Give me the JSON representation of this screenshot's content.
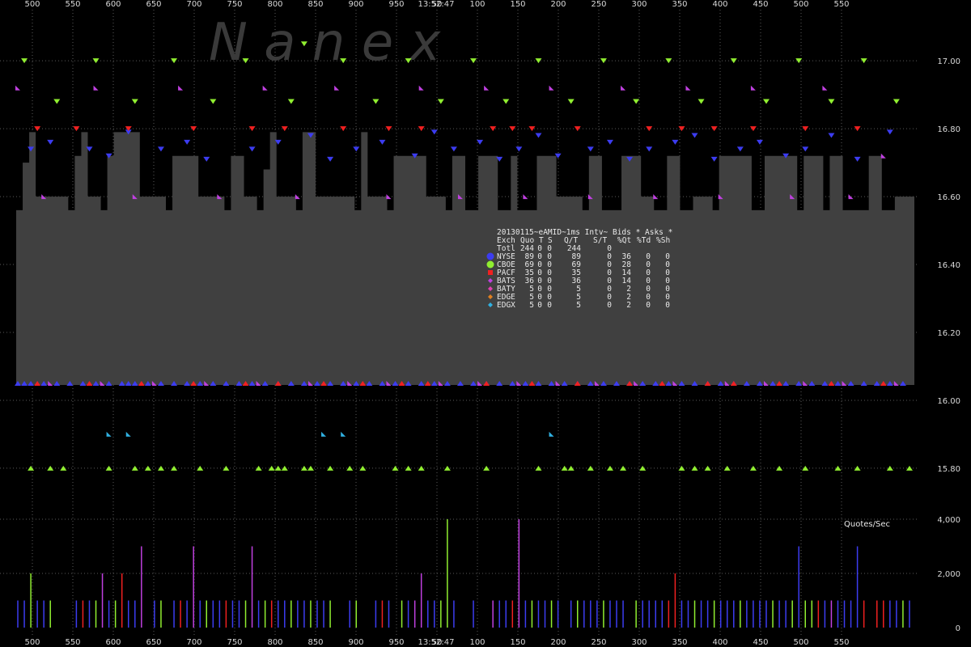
{
  "chart_data": {
    "type": "step-area",
    "watermark": "N a n e x",
    "top_time_label": "13:52:47",
    "bottom_time_label": "13:52:47",
    "x_ticks": [
      "500",
      "550",
      "600",
      "650",
      "700",
      "750",
      "800",
      "850",
      "900",
      "950",
      "50",
      "100",
      "150",
      "200",
      "250",
      "300",
      "350",
      "400",
      "450",
      "500",
      "550"
    ],
    "price_axis": {
      "ylim": [
        15.745,
        17.06
      ],
      "ticks": [
        "17.00",
        "16.80",
        "16.60",
        "16.40",
        "16.20",
        "16.00",
        "15.80"
      ]
    },
    "rate_axis": {
      "title": "Quotes/Sec",
      "ylim": [
        0,
        4100
      ],
      "ticks": [
        "4,000",
        "2,000",
        "0"
      ]
    },
    "colors": {
      "background": "#000000",
      "grid": "#5a5a5a",
      "area": "#404040",
      "NYSE": "#3c3cf0",
      "CBOE": "#90ee30",
      "PACF": "#f02020",
      "BATS": "#c040e0",
      "BATY": "#e040b0",
      "EDGE": "#e08020",
      "EDGX": "#30b0e0"
    },
    "legend": {
      "title": "20130115~eAMID~1ms Intv~ Bids * Asks *",
      "header": [
        "Exch",
        "Quo",
        "T",
        "S",
        "Q/T",
        "S/T",
        "%Qt",
        "%Td",
        "%Sh"
      ],
      "total": {
        "label": "Totl",
        "quo": "244",
        "t": "0",
        "s": "0",
        "qt": "244",
        "st": "0",
        "pqt": "",
        "ptd": "",
        "psh": ""
      },
      "rows": [
        {
          "exch": "NYSE",
          "quo": "89",
          "t": "0",
          "s": "0",
          "qt": "89",
          "st": "0",
          "pqt": "36",
          "ptd": "0",
          "psh": "0",
          "color": "#3c3cf0",
          "marker": "circle"
        },
        {
          "exch": "CBOE",
          "quo": "69",
          "t": "0",
          "s": "0",
          "qt": "69",
          "st": "0",
          "pqt": "28",
          "ptd": "0",
          "psh": "0",
          "color": "#90ee30",
          "marker": "circle"
        },
        {
          "exch": "PACF",
          "quo": "35",
          "t": "0",
          "s": "0",
          "qt": "35",
          "st": "0",
          "pqt": "14",
          "ptd": "0",
          "psh": "0",
          "color": "#f02020",
          "marker": "square"
        },
        {
          "exch": "BATS",
          "quo": "36",
          "t": "0",
          "s": "0",
          "qt": "36",
          "st": "0",
          "pqt": "14",
          "ptd": "0",
          "psh": "0",
          "color": "#c040e0",
          "marker": "diamond"
        },
        {
          "exch": "BATY",
          "quo": "5",
          "t": "0",
          "s": "0",
          "qt": "5",
          "st": "0",
          "pqt": "2",
          "ptd": "0",
          "psh": "0",
          "color": "#e040b0",
          "marker": "diamond"
        },
        {
          "exch": "EDGE",
          "quo": "5",
          "t": "0",
          "s": "0",
          "qt": "5",
          "st": "0",
          "pqt": "2",
          "ptd": "0",
          "psh": "0",
          "color": "#e08020",
          "marker": "diamond"
        },
        {
          "exch": "EDGX",
          "quo": "5",
          "t": "0",
          "s": "0",
          "qt": "5",
          "st": "0",
          "pqt": "2",
          "ptd": "0",
          "psh": "0",
          "color": "#30b0e0",
          "marker": "diamond"
        }
      ]
    },
    "best_bid": 16.05,
    "best_ask": [
      [
        0,
        16.56
      ],
      [
        1,
        16.7
      ],
      [
        2,
        16.79
      ],
      [
        3,
        16.6
      ],
      [
        8,
        16.56
      ],
      [
        9,
        16.72
      ],
      [
        10,
        16.79
      ],
      [
        11,
        16.6
      ],
      [
        13,
        16.56
      ],
      [
        14,
        16.72
      ],
      [
        15,
        16.79
      ],
      [
        19,
        16.6
      ],
      [
        23,
        16.56
      ],
      [
        24,
        16.72
      ],
      [
        28,
        16.6
      ],
      [
        32,
        16.56
      ],
      [
        33,
        16.72
      ],
      [
        35,
        16.6
      ],
      [
        37,
        16.56
      ],
      [
        38,
        16.68
      ],
      [
        39,
        16.79
      ],
      [
        40,
        16.6
      ],
      [
        43,
        16.56
      ],
      [
        44,
        16.79
      ],
      [
        46,
        16.6
      ],
      [
        52,
        16.56
      ],
      [
        53,
        16.79
      ],
      [
        54,
        16.6
      ],
      [
        57,
        16.56
      ],
      [
        58,
        16.72
      ],
      [
        63,
        16.6
      ],
      [
        66,
        16.56
      ],
      [
        67,
        16.72
      ],
      [
        69,
        16.56
      ],
      [
        71,
        16.72
      ],
      [
        74,
        16.56
      ],
      [
        76,
        16.72
      ],
      [
        77,
        16.56
      ],
      [
        80,
        16.72
      ],
      [
        83,
        16.6
      ],
      [
        87,
        16.56
      ],
      [
        88,
        16.72
      ],
      [
        90,
        16.56
      ],
      [
        93,
        16.72
      ],
      [
        96,
        16.6
      ],
      [
        98,
        16.56
      ],
      [
        100,
        16.72
      ],
      [
        102,
        16.56
      ],
      [
        104,
        16.6
      ],
      [
        107,
        16.56
      ],
      [
        108,
        16.72
      ],
      [
        113,
        16.56
      ],
      [
        115,
        16.72
      ],
      [
        120,
        16.56
      ],
      [
        121,
        16.72
      ],
      [
        124,
        16.56
      ],
      [
        125,
        16.72
      ],
      [
        127,
        16.56
      ],
      [
        131,
        16.72
      ],
      [
        133,
        16.56
      ],
      [
        135,
        16.6
      ],
      [
        138,
        16.56
      ]
    ],
    "ask_markers": [
      {
        "e": "CBOE",
        "t": [
          1,
          6,
          12,
          18,
          24,
          30,
          35,
          42,
          50,
          55,
          60,
          65,
          70,
          75,
          80,
          85,
          90,
          95,
          100,
          105,
          110,
          115,
          120,
          125,
          130,
          135
        ],
        "p": [
          17.0,
          16.88,
          17.0,
          16.88,
          17.0,
          16.88,
          17.0,
          16.88,
          17.0,
          16.88,
          17.0,
          16.88,
          17.0,
          16.88,
          17.0,
          16.88,
          17.0,
          16.88,
          17.0,
          16.88,
          17.0,
          16.88,
          17.0,
          16.88,
          17.0,
          16.88
        ]
      },
      {
        "e": "NYSE",
        "t": [
          2,
          5,
          11,
          14,
          17,
          22,
          26,
          29,
          36,
          40,
          45,
          48,
          52,
          56,
          61,
          64,
          67,
          71,
          74,
          77,
          80,
          83,
          88,
          91,
          94,
          97,
          101,
          104,
          107,
          111,
          114,
          118,
          121,
          125,
          129,
          134
        ],
        "p": [
          16.74,
          16.76,
          16.74,
          16.72,
          16.79,
          16.74,
          16.76,
          16.71,
          16.74,
          16.76,
          16.78,
          16.71,
          16.74,
          16.76,
          16.72,
          16.79,
          16.74,
          16.76,
          16.71,
          16.74,
          16.78,
          16.72,
          16.74,
          16.76,
          16.71,
          16.74,
          16.76,
          16.78,
          16.71,
          16.74,
          16.76,
          16.72,
          16.74,
          16.78,
          16.71,
          16.79
        ]
      },
      {
        "e": "PACF",
        "t": [
          3,
          9,
          17,
          27,
          36,
          41,
          50,
          57,
          62,
          73,
          76,
          79,
          86,
          97,
          102,
          107,
          113,
          121,
          129
        ],
        "p": [
          16.8,
          16.8,
          16.8,
          16.8,
          16.8,
          16.8,
          16.8,
          16.8,
          16.8,
          16.8,
          16.8,
          16.8,
          16.8,
          16.8,
          16.8,
          16.8,
          16.8,
          16.8,
          16.8
        ]
      },
      {
        "e": "BATS",
        "t": [
          0,
          4,
          12,
          18,
          25,
          31,
          38,
          43,
          49,
          57,
          62,
          68,
          72,
          78,
          82,
          88,
          93,
          98,
          103,
          108,
          113,
          119,
          124,
          128,
          133
        ],
        "p": [
          16.92,
          16.6,
          16.92,
          16.6,
          16.92,
          16.6,
          16.92,
          16.6,
          16.92,
          16.6,
          16.92,
          16.6,
          16.92,
          16.6,
          16.92,
          16.6,
          16.92,
          16.6,
          16.92,
          16.6,
          16.92,
          16.6,
          16.92,
          16.6,
          16.72
        ]
      },
      {
        "e": "CBOE",
        "t": [
          44
        ],
        "p": [
          17.05
        ]
      }
    ],
    "bid_markers": [
      {
        "e": "NYSE",
        "t": [
          0,
          1,
          2,
          4,
          6,
          8,
          10,
          12,
          14,
          16,
          17,
          18,
          20,
          22,
          24,
          26,
          28,
          30,
          32,
          34,
          36,
          38,
          40,
          42,
          44,
          46,
          48,
          50,
          52,
          54,
          56,
          58,
          60,
          62,
          64,
          66,
          68,
          70,
          72,
          74,
          76,
          78,
          80,
          82,
          84,
          86,
          88,
          90,
          92,
          94,
          96,
          98,
          100,
          102,
          104,
          106,
          108,
          110,
          112,
          114,
          116,
          118,
          120,
          122,
          124,
          126,
          128,
          130,
          132,
          134,
          136
        ],
        "p": 16.05
      },
      {
        "e": "PACF",
        "t": [
          3,
          11,
          19,
          27,
          35,
          40,
          47,
          53,
          59,
          63,
          72,
          79,
          86,
          94,
          99,
          106,
          110,
          117,
          125,
          133
        ],
        "p": 16.05
      },
      {
        "e": "BATS",
        "t": [
          5,
          13,
          21,
          29,
          37,
          45,
          51,
          57,
          65,
          71,
          77,
          83,
          89,
          95,
          101,
          109,
          115,
          121,
          127,
          135
        ],
        "p": 16.05
      },
      {
        "e": "EDGX",
        "t": [
          14,
          17,
          47,
          50,
          82
        ],
        "p": 15.9
      },
      {
        "e": "CBOE",
        "t": [
          2,
          5,
          7,
          14,
          18,
          20,
          22,
          24,
          28,
          32,
          37,
          39,
          40,
          41,
          44,
          45,
          48,
          51,
          53,
          58,
          60,
          62,
          66,
          72,
          80,
          84,
          85,
          88,
          91,
          93,
          96,
          102,
          104,
          106,
          109,
          113,
          117,
          121,
          126,
          129,
          134,
          137
        ],
        "p": 15.8
      }
    ],
    "rate_series": {
      "t": [
        0,
        1,
        2,
        3,
        4,
        5,
        6,
        7,
        8,
        9,
        10,
        11,
        12,
        13,
        14,
        15,
        16,
        17,
        18,
        19,
        20,
        21,
        22,
        23,
        24,
        25,
        26,
        27,
        28,
        29,
        30,
        31,
        32,
        33,
        34,
        35,
        36,
        37,
        38,
        39,
        40,
        41,
        42,
        43,
        44,
        45,
        46,
        47,
        48,
        49,
        50,
        51,
        52,
        53,
        54,
        55,
        56,
        57,
        58,
        59,
        60,
        61,
        62,
        63,
        64,
        65,
        66,
        67,
        68,
        69,
        70,
        71,
        72,
        73,
        74,
        75,
        76,
        77,
        78,
        79,
        80,
        81,
        82,
        83,
        84,
        85,
        86,
        87,
        88,
        89,
        90,
        91,
        92,
        93,
        94,
        95,
        96,
        97,
        98,
        99,
        100,
        101,
        102,
        103,
        104,
        105,
        106,
        107,
        108,
        109,
        110,
        111,
        112,
        113,
        114,
        115,
        116,
        117,
        118,
        119,
        120,
        121,
        122,
        123,
        124,
        125,
        126,
        127,
        128,
        129,
        130,
        131,
        132,
        133,
        134,
        135,
        136,
        137
      ],
      "v": [
        1000,
        1000,
        2000,
        1000,
        1000,
        1000,
        0,
        0,
        0,
        1000,
        1000,
        1000,
        1000,
        2000,
        1000,
        1000,
        2000,
        1000,
        1000,
        3000,
        0,
        1000,
        1000,
        0,
        1000,
        1000,
        1000,
        3000,
        1000,
        1000,
        1000,
        1000,
        1000,
        1000,
        1000,
        1000,
        3000,
        1000,
        1000,
        1000,
        1000,
        1000,
        1000,
        1000,
        1000,
        1000,
        1000,
        1000,
        1000,
        0,
        0,
        1000,
        1000,
        0,
        0,
        1000,
        1000,
        1000,
        0,
        1000,
        1000,
        1000,
        2000,
        1000,
        1000,
        1000,
        4000,
        1000,
        0,
        0,
        1000,
        0,
        0,
        1000,
        1000,
        1000,
        1000,
        4000,
        1000,
        1000,
        1000,
        1000,
        1000,
        1000,
        0,
        1000,
        1000,
        1000,
        1000,
        1000,
        1000,
        1000,
        1000,
        1000,
        0,
        1000,
        1000,
        1000,
        1000,
        1000,
        1000,
        2000,
        1000,
        1000,
        1000,
        1000,
        1000,
        1000,
        1000,
        1000,
        1000,
        1000,
        1000,
        1000,
        1000,
        1000,
        1000,
        1000,
        1000,
        1000,
        3000,
        1000,
        1000,
        1000,
        1000,
        1000,
        1000,
        1000,
        1000,
        3000,
        1000,
        0,
        1000,
        1000,
        1000,
        1000,
        1000,
        1000,
        2000,
        1000,
        1000,
        1000
      ],
      "e": [
        "NYSE",
        "NYSE",
        "CBOE",
        "NYSE",
        "NYSE",
        "CBOE",
        "NYSE",
        "NYSE",
        "NYSE",
        "NYSE",
        "PACF",
        "NYSE",
        "CBOE",
        "BATS",
        "NYSE",
        "CBOE",
        "PACF",
        "NYSE",
        "NYSE",
        "BATS",
        "NYSE",
        "NYSE",
        "CBOE",
        "NYSE",
        "NYSE",
        "PACF",
        "NYSE",
        "BATS",
        "NYSE",
        "CBOE",
        "NYSE",
        "NYSE",
        "PACF",
        "NYSE",
        "NYSE",
        "CBOE",
        "BATS",
        "NYSE",
        "CBOE",
        "PACF",
        "NYSE",
        "NYSE",
        "CBOE",
        "NYSE",
        "NYSE",
        "CBOE",
        "NYSE",
        "NYSE",
        "CBOE",
        "NYSE",
        "NYSE",
        "NYSE",
        "CBOE",
        "NYSE",
        "NYSE",
        "NYSE",
        "PACF",
        "NYSE",
        "NYSE",
        "CBOE",
        "NYSE",
        "BATS",
        "BATS",
        "NYSE",
        "NYSE",
        "CBOE",
        "CBOE",
        "NYSE",
        "NYSE",
        "NYSE",
        "NYSE",
        "NYSE",
        "NYSE",
        "BATS",
        "NYSE",
        "NYSE",
        "PACF",
        "BATS",
        "NYSE",
        "CBOE",
        "NYSE",
        "NYSE",
        "CBOE",
        "NYSE",
        "NYSE",
        "NYSE",
        "CBOE",
        "NYSE",
        "NYSE",
        "NYSE",
        "CBOE",
        "NYSE",
        "NYSE",
        "NYSE",
        "NYSE",
        "CBOE",
        "NYSE",
        "NYSE",
        "NYSE",
        "NYSE",
        "PACF",
        "PACF",
        "NYSE",
        "NYSE",
        "CBOE",
        "NYSE",
        "NYSE",
        "CBOE",
        "NYSE",
        "NYSE",
        "NYSE",
        "CBOE",
        "NYSE",
        "NYSE",
        "NYSE",
        "NYSE",
        "CBOE",
        "NYSE",
        "NYSE",
        "CBOE",
        "NYSE",
        "CBOE",
        "CBOE",
        "PACF",
        "NYSE",
        "BATS",
        "NYSE",
        "NYSE",
        "NYSE",
        "NYSE",
        "PACF",
        "NYSE",
        "PACF",
        "PACF",
        "NYSE",
        "NYSE",
        "CBOE",
        "NYSE"
      ]
    }
  }
}
